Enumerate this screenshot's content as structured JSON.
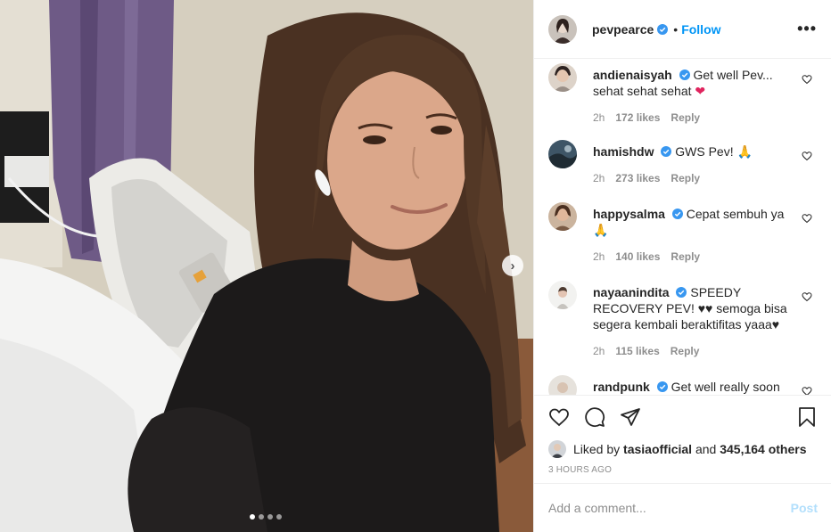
{
  "post": {
    "username": "pevpearce",
    "follow_label": "Follow",
    "separator": "•",
    "more_label": "•••",
    "carousel": {
      "slide_count": 4,
      "active_index": 0
    }
  },
  "comments": [
    {
      "username": "andienaisyah",
      "text": "Get well Pev... sehat sehat sehat",
      "emoji": "❤",
      "time": "2h",
      "likes": "172 likes",
      "reply": "Reply"
    },
    {
      "username": "hamishdw",
      "text": "GWS Pev!",
      "emoji": "🙏",
      "time": "2h",
      "likes": "273 likes",
      "reply": "Reply"
    },
    {
      "username": "happysalma",
      "text": "Cepat sembuh ya",
      "emoji": "🙏",
      "time": "2h",
      "likes": "140 likes",
      "reply": "Reply"
    },
    {
      "username": "nayaanindita",
      "text": "SPEEDY RECOVERY PEV! ♥♥ semoga bisa segera kembali beraktifitas yaaa♥",
      "emoji": "",
      "time": "2h",
      "likes": "115 likes",
      "reply": "Reply"
    },
    {
      "username": "randpunk",
      "text": "Get well really soon",
      "emoji": "",
      "time": "",
      "likes": "",
      "reply": ""
    }
  ],
  "likes": {
    "prefix": "Liked by",
    "user": "tasiaofficial",
    "connector": "and",
    "others": "345,164 others"
  },
  "timestamp": "3 HOURS AGO",
  "add_comment": {
    "placeholder": "Add a comment...",
    "post_label": "Post"
  },
  "colors": {
    "accent": "#0095f6",
    "verified": "#3897f0",
    "muted": "#8e8e8e",
    "post_disabled": "#b2dffc"
  }
}
